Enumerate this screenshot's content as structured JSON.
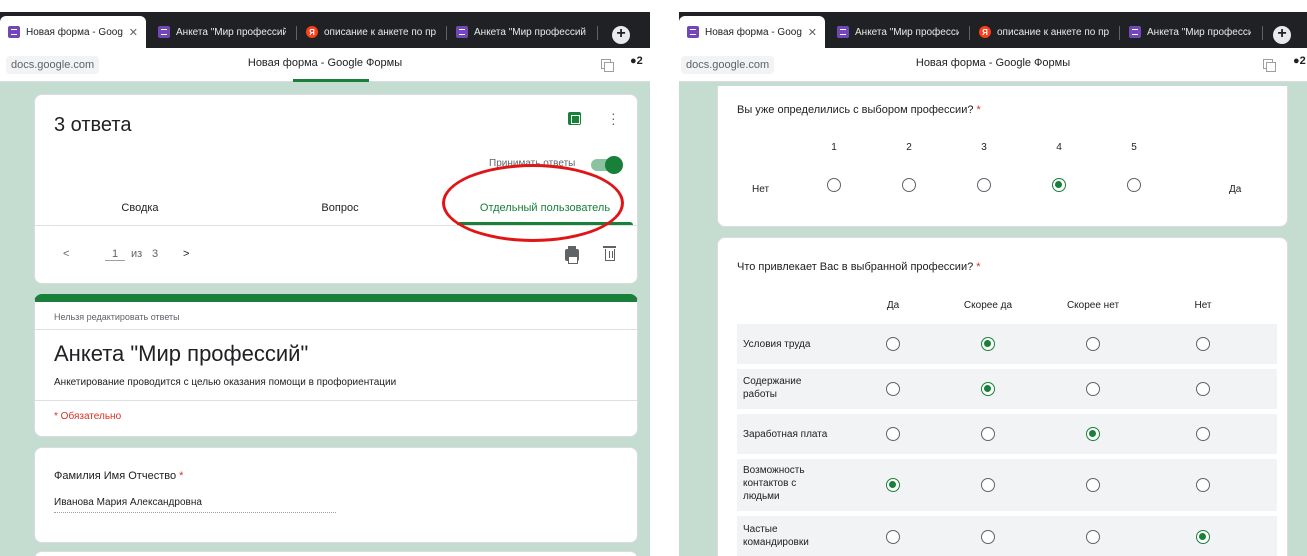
{
  "left": {
    "tabs": [
      {
        "label": "Новая форма - Googl",
        "active": true
      },
      {
        "label": "Анкета \"Мир профессий"
      },
      {
        "label": "описание к анкете по пр"
      },
      {
        "label": "Анкета \"Мир профессий"
      }
    ],
    "url": "docs.google.com",
    "page_title": "Новая форма - Google Формы",
    "comments_count": "2",
    "responses": {
      "count_title": "3 ответа",
      "accept_label": "Принимать ответы",
      "tabs": [
        "Сводка",
        "Вопрос",
        "Отдельный пользователь"
      ],
      "current": "1",
      "of_label": "из",
      "total": "3"
    },
    "form": {
      "notice": "Нельзя редактировать ответы",
      "title": "Анкета \"Мир профессий\"",
      "description": "Анкетирование проводится с целью оказания помощи в профориентации",
      "required_note": "* Обязательно"
    },
    "question": {
      "label": "Фамилия Имя Отчество",
      "star": "*",
      "answer": "Иванова Мария Александровна"
    }
  },
  "right": {
    "tabs": [
      {
        "label": "Новая форма - Googl",
        "active": true
      },
      {
        "label": "Анкета \"Мир профессий"
      },
      {
        "label": "описание к анкете по пр"
      },
      {
        "label": "Анкета \"Мир профессий"
      }
    ],
    "url": "docs.google.com",
    "page_title": "Новая форма - Google Формы",
    "comments_count": "2",
    "scale_question": {
      "label": "Вы уже определились с выбором профессии?",
      "star": "*",
      "low_label": "Нет",
      "high_label": "Да",
      "numbers": [
        "1",
        "2",
        "3",
        "4",
        "5"
      ],
      "selected": 4
    },
    "grid_question": {
      "label": "Что привлекает Вас в выбранной профессии?",
      "star": "*",
      "columns": [
        "Да",
        "Скорее да",
        "Скорее нет",
        "Нет"
      ],
      "rows": [
        {
          "label": "Условия труда",
          "selected": 2
        },
        {
          "label": "Содержание\nработы",
          "selected": 2
        },
        {
          "label": "Заработная плата",
          "selected": 3
        },
        {
          "label": "Возможность\nконтактов с\nлюдьми",
          "selected": 1
        },
        {
          "label": "Частые\nкомандировки",
          "selected": 4
        }
      ]
    }
  },
  "colors": {
    "accent": "#188038",
    "page_background": "#c5ddd1",
    "required": "#d93025",
    "annotation": "#e01515",
    "tabbar": "#202124"
  }
}
